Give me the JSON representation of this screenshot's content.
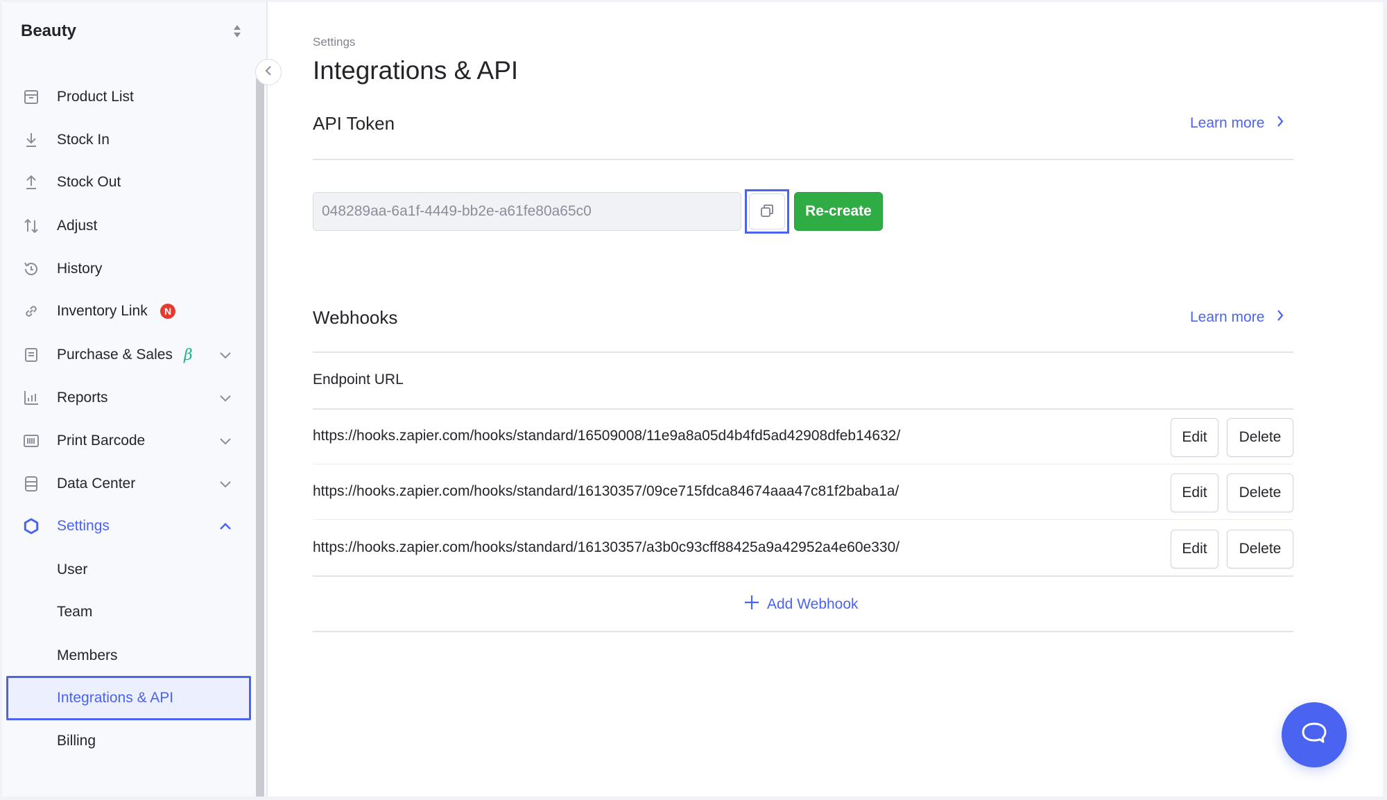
{
  "sidebar": {
    "workspace": "Beauty",
    "items": [
      {
        "label": "Product List",
        "icon": "box-icon"
      },
      {
        "label": "Stock In",
        "icon": "arrow-down-icon"
      },
      {
        "label": "Stock Out",
        "icon": "arrow-up-icon"
      },
      {
        "label": "Adjust",
        "icon": "swap-vertical-icon"
      },
      {
        "label": "History",
        "icon": "history-icon"
      },
      {
        "label": "Inventory Link",
        "icon": "link-icon",
        "badge": "N"
      },
      {
        "label": "Purchase & Sales",
        "icon": "document-icon",
        "tag": "β",
        "expandable": true
      },
      {
        "label": "Reports",
        "icon": "bar-chart-icon",
        "expandable": true
      },
      {
        "label": "Print Barcode",
        "icon": "barcode-icon",
        "expandable": true
      },
      {
        "label": "Data Center",
        "icon": "database-icon",
        "expandable": true
      },
      {
        "label": "Settings",
        "icon": "gear-icon",
        "expandable": true,
        "expanded": true,
        "active": true
      }
    ],
    "settings_subitems": [
      {
        "label": "User"
      },
      {
        "label": "Team"
      },
      {
        "label": "Members"
      },
      {
        "label": "Integrations & API",
        "selected": true
      },
      {
        "label": "Billing"
      }
    ]
  },
  "header": {
    "breadcrumb": "Settings",
    "title": "Integrations & API"
  },
  "api_token": {
    "title": "API Token",
    "learn_more": "Learn more",
    "token_value": "048289aa-6a1f-4449-bb2e-a61fe80a65c0",
    "recreate_label": "Re-create"
  },
  "webhooks": {
    "title": "Webhooks",
    "learn_more": "Learn more",
    "column_header": "Endpoint URL",
    "rows": [
      {
        "url": "https://hooks.zapier.com/hooks/standard/16509008/11e9a8a05d4b4fd5ad42908dfeb14632/",
        "edit": "Edit",
        "delete": "Delete"
      },
      {
        "url": "https://hooks.zapier.com/hooks/standard/16130357/09ce715fdca84674aaa47c81f2baba1a/",
        "edit": "Edit",
        "delete": "Delete"
      },
      {
        "url": "https://hooks.zapier.com/hooks/standard/16130357/a3b0c93cff88425a9a42952a4e60e330/",
        "edit": "Edit",
        "delete": "Delete"
      }
    ],
    "add_label": "Add Webhook"
  },
  "colors": {
    "accent": "#4a63f0",
    "success": "#2fac44",
    "badge": "#e53a2f",
    "beta": "#20b08a"
  }
}
